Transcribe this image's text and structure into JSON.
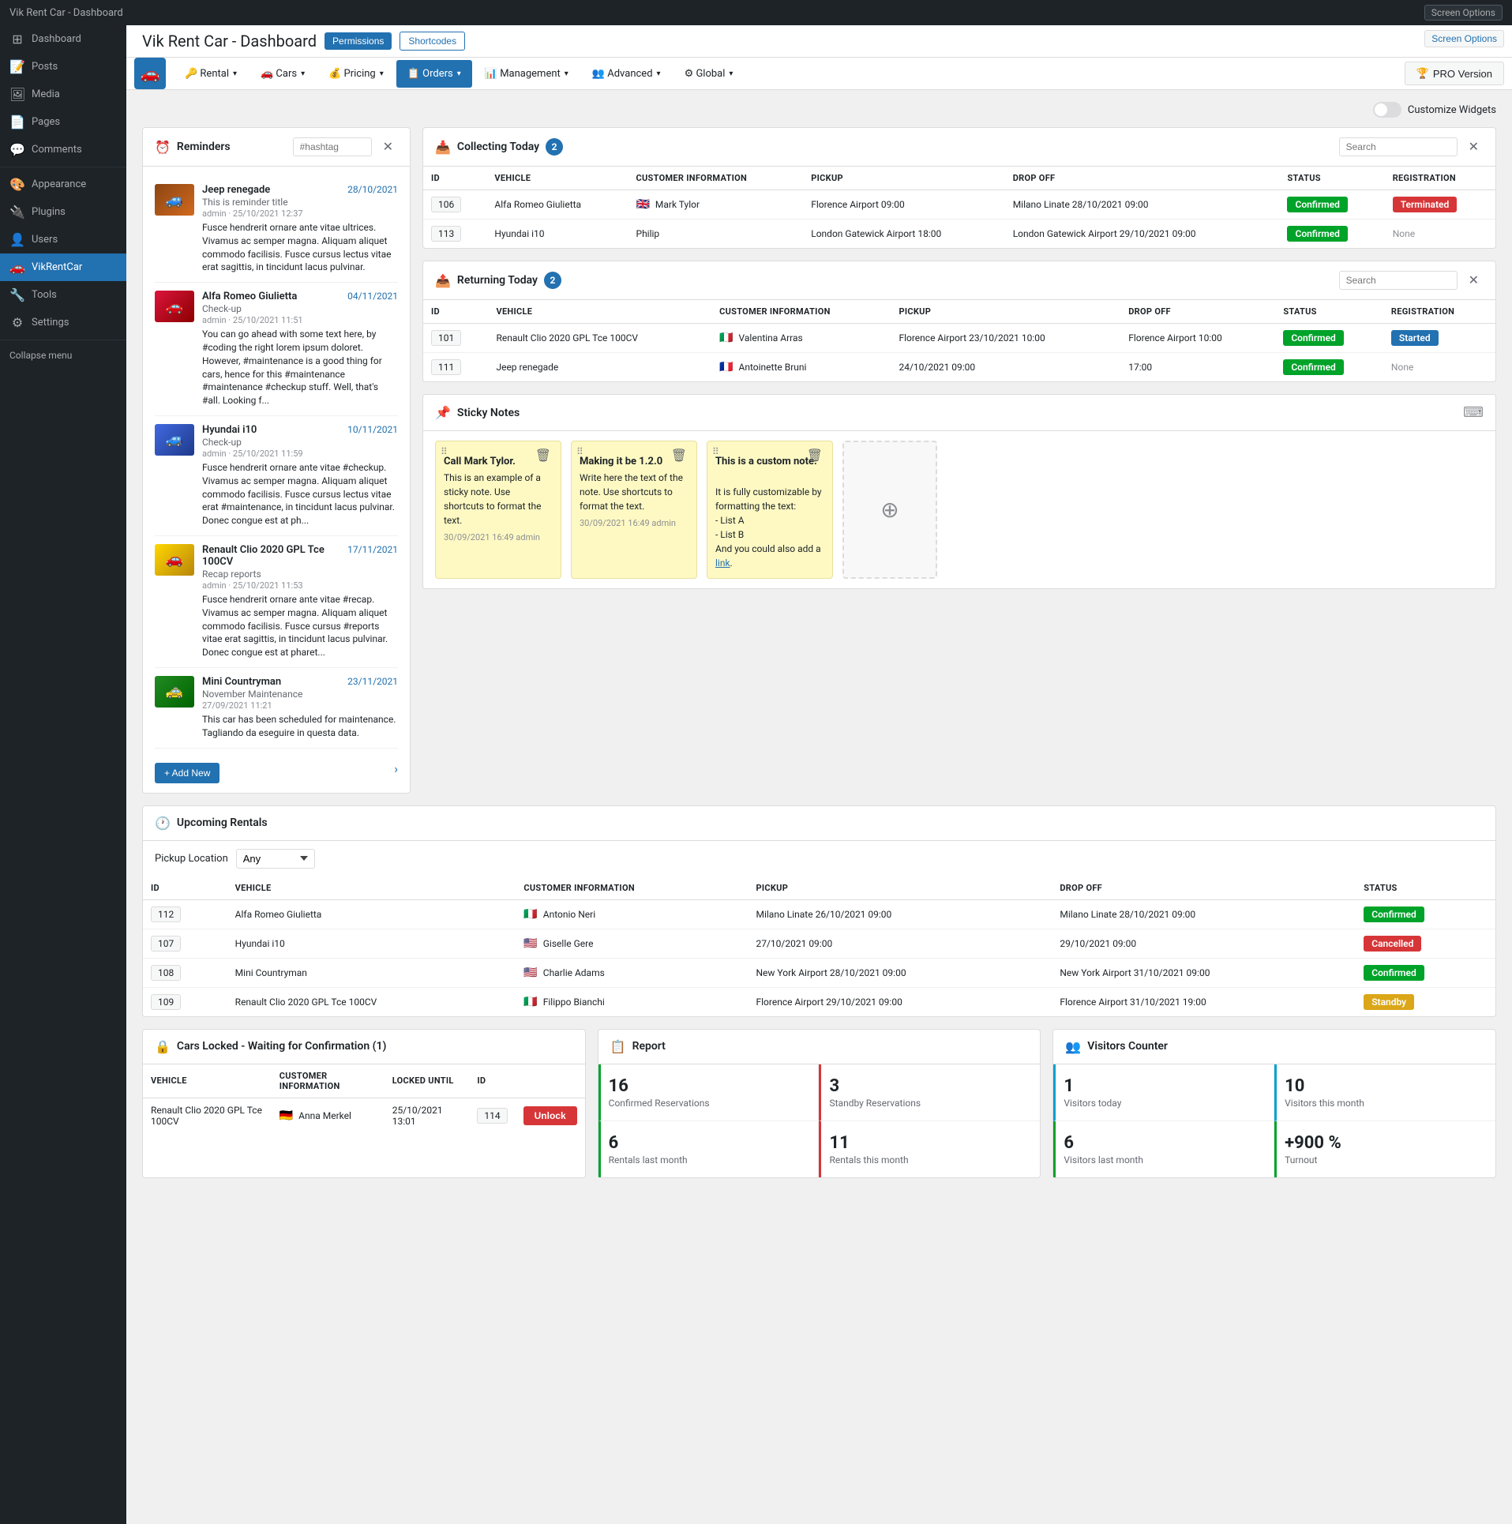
{
  "adminBar": {
    "screenOptions": "Screen Options"
  },
  "pageHeader": {
    "title": "Vik Rent Car - Dashboard",
    "permissionsLabel": "Permissions",
    "shortcodesLabel": "Shortcodes"
  },
  "nav": {
    "logoIcon": "🚗",
    "items": [
      {
        "label": "Rental",
        "hasDropdown": true
      },
      {
        "label": "Cars",
        "hasDropdown": true
      },
      {
        "label": "Pricing",
        "hasDropdown": true
      },
      {
        "label": "Orders",
        "hasDropdown": true,
        "active": true
      },
      {
        "label": "Management",
        "hasDropdown": true
      },
      {
        "label": "Advanced",
        "hasDropdown": true
      },
      {
        "label": "Global",
        "hasDropdown": true
      }
    ],
    "proVersion": "PRO Version"
  },
  "sidebar": {
    "items": [
      {
        "label": "Dashboard",
        "icon": "⊞",
        "active": false
      },
      {
        "label": "Posts",
        "icon": "📝",
        "active": false
      },
      {
        "label": "Media",
        "icon": "🖼",
        "active": false
      },
      {
        "label": "Pages",
        "icon": "📄",
        "active": false
      },
      {
        "label": "Comments",
        "icon": "💬",
        "active": false
      },
      {
        "label": "Appearance",
        "icon": "🎨",
        "active": false
      },
      {
        "label": "Plugins",
        "icon": "🔌",
        "active": false
      },
      {
        "label": "Users",
        "icon": "👤",
        "active": false
      },
      {
        "label": "VikRentCar",
        "icon": "🚗",
        "active": true
      },
      {
        "label": "Tools",
        "icon": "🔧",
        "active": false
      },
      {
        "label": "Settings",
        "icon": "⚙",
        "active": false
      }
    ],
    "collapse": "Collapse menu"
  },
  "customize": {
    "label": "Customize Widgets"
  },
  "reminders": {
    "title": "Reminders",
    "searchPlaceholder": "#hashtag",
    "addNewLabel": "+ Add New",
    "items": [
      {
        "car": "Jeep renegade",
        "subtitle": "This is reminder title",
        "date": "28/10/2021",
        "meta": "admin · 25/10/2021 12:37",
        "text": "Fusce hendrerit ornare ante vitae ultrices. Vivamus ac semper magna. Aliquam aliquet commodo facilisis. Fusce cursus lectus vitae erat sagittis, in tincidunt lacus pulvinar.",
        "carColor": "car-jeep"
      },
      {
        "car": "Alfa Romeo Giulietta",
        "subtitle": "Check-up",
        "date": "04/11/2021",
        "meta": "admin · 25/10/2021 11:51",
        "text": "You can go ahead with some text here, by #coding the right lorem ipsum doloret. However, #maintenance is a good thing for cars, hence for this #maintenance #maintenance #checkup stuff. Well, that's #all. Looking f...",
        "carColor": "car-alfa"
      },
      {
        "car": "Hyundai i10",
        "subtitle": "Check-up",
        "date": "10/11/2021",
        "meta": "admin · 25/10/2021 11:59",
        "text": "Fusce hendrerit ornare ante vitae #checkup. Vivamus ac semper magna. Aliquam aliquet commodo facilisis. Fusce cursus lectus vitae erat #maintenance, in tincidunt lacus pulvinar. Donec congue est at ph...",
        "carColor": "car-hyundai"
      },
      {
        "car": "Renault Clio 2020 GPL Tce 100CV",
        "subtitle": "Recap reports",
        "date": "17/11/2021",
        "meta": "admin · 25/10/2021 11:53",
        "text": "Fusce hendrerit ornare ante vitae #recap. Vivamus ac semper magna. Aliquam aliquet commodo facilisis. Fusce cursus #reports vitae erat sagittis, in tincidunt lacus pulvinar. Donec congue est at pharet...",
        "carColor": "car-renault"
      },
      {
        "car": "Mini Countryman",
        "subtitle": "November Maintenance",
        "date": "23/11/2021",
        "meta": "27/09/2021 11:21",
        "text": "This car has been scheduled for maintenance. Tagliando da eseguire in questa data.",
        "carColor": "car-mini"
      }
    ]
  },
  "collectingToday": {
    "title": "Collecting Today",
    "count": "2",
    "columns": [
      "ID",
      "VEHICLE",
      "CUSTOMER INFORMATION",
      "PICKUP",
      "DROP OFF",
      "STATUS",
      "REGISTRATION"
    ],
    "rows": [
      {
        "id": "106",
        "vehicle": "Alfa Romeo Giulietta",
        "customerFlag": "🇬🇧",
        "customer": "Mark Tylor",
        "pickup": "Florence Airport 09:00",
        "dropoff": "Milano Linate 28/10/2021 09:00",
        "status": "Confirmed",
        "statusClass": "status-confirmed",
        "registration": "Terminated",
        "regClass": "status-terminated"
      },
      {
        "id": "113",
        "vehicle": "Hyundai i10",
        "customerFlag": "",
        "customer": "Philip",
        "pickup": "London Gatewick Airport 18:00",
        "dropoff": "London Gatewick Airport 29/10/2021 09:00",
        "status": "Confirmed",
        "statusClass": "status-confirmed",
        "registration": "None",
        "regClass": "status-none"
      }
    ]
  },
  "returningToday": {
    "title": "Returning Today",
    "count": "2",
    "columns": [
      "ID",
      "VEHICLE",
      "CUSTOMER INFORMATION",
      "PICKUP",
      "DROP OFF",
      "STATUS",
      "REGISTRATION"
    ],
    "rows": [
      {
        "id": "101",
        "vehicle": "Renault Clio 2020 GPL Tce 100CV",
        "customerFlag": "🇮🇹",
        "customer": "Valentina Arras",
        "pickup": "Florence Airport 23/10/2021 10:00",
        "dropoff": "Florence Airport 10:00",
        "status": "Confirmed",
        "statusClass": "status-confirmed",
        "registration": "Started",
        "regClass": "status-started"
      },
      {
        "id": "111",
        "vehicle": "Jeep renegade",
        "customerFlag": "🇫🇷",
        "customer": "Antoinette Bruni",
        "pickup": "24/10/2021 09:00",
        "dropoff": "17:00",
        "status": "Confirmed",
        "statusClass": "status-confirmed",
        "registration": "None",
        "regClass": "status-none"
      }
    ]
  },
  "stickyNotes": {
    "title": "Sticky Notes",
    "notes": [
      {
        "title": "Call Mark Tylor.",
        "text": "This is an example of a sticky note. Use shortcuts to format the text.",
        "meta": "30/09/2021 16:49 admin"
      },
      {
        "title": "Making it be 1.2.0",
        "text": "Write here the text of the note. Use shortcuts to format the text.",
        "meta": "30/09/2021 16:49 admin"
      },
      {
        "title": "This is a custom note.",
        "text": "It is fully customizable by formatting the text:\n- List A\n- List B\nAnd you could also add a link.",
        "meta": ""
      }
    ]
  },
  "upcomingRentals": {
    "title": "Upcoming Rentals",
    "pickupLabel": "Pickup Location",
    "pickupValue": "Any",
    "pickupOptions": [
      "Any"
    ],
    "columns": [
      "ID",
      "VEHICLE",
      "CUSTOMER INFORMATION",
      "PICKUP",
      "DROP OFF",
      "STATUS"
    ],
    "rows": [
      {
        "id": "112",
        "vehicle": "Alfa Romeo Giulietta",
        "customerFlag": "🇮🇹",
        "customer": "Antonio Neri",
        "pickup": "Milano Linate 26/10/2021 09:00",
        "dropoff": "Milano Linate 28/10/2021 09:00",
        "status": "Confirmed",
        "statusClass": "status-confirmed"
      },
      {
        "id": "107",
        "vehicle": "Hyundai i10",
        "customerFlag": "🇺🇸",
        "customer": "Giselle Gere",
        "pickup": "27/10/2021 09:00",
        "dropoff": "29/10/2021 09:00",
        "status": "Cancelled",
        "statusClass": "status-cancelled"
      },
      {
        "id": "108",
        "vehicle": "Mini Countryman",
        "customerFlag": "🇺🇸",
        "customer": "Charlie Adams",
        "pickup": "New York Airport 28/10/2021 09:00",
        "dropoff": "New York Airport 31/10/2021 09:00",
        "status": "Confirmed",
        "statusClass": "status-confirmed"
      },
      {
        "id": "109",
        "vehicle": "Renault Clio 2020 GPL Tce 100CV",
        "customerFlag": "🇮🇹",
        "customer": "Filippo Bianchi",
        "pickup": "Florence Airport 29/10/2021 09:00",
        "dropoff": "Florence Airport 31/10/2021 19:00",
        "status": "Standby",
        "statusClass": "status-standby"
      }
    ]
  },
  "carsLocked": {
    "title": "Cars Locked - Waiting for Confirmation (1)",
    "columns": [
      "VEHICLE",
      "CUSTOMER INFORMATION",
      "LOCKED UNTIL",
      "ID"
    ],
    "rows": [
      {
        "vehicle": "Renault Clio 2020 GPL Tce 100CV",
        "customerFlag": "🇩🇪",
        "customer": "Anna Merkel",
        "lockedUntil": "25/10/2021 13:01",
        "id": "114",
        "unlockLabel": "Unlock"
      }
    ]
  },
  "report": {
    "title": "Report",
    "stats": [
      {
        "number": "16",
        "label": "Confirmed Reservations",
        "accent": "green"
      },
      {
        "number": "3",
        "label": "Standby Reservations",
        "accent": "red"
      },
      {
        "number": "6",
        "label": "Rentals last month",
        "accent": "green"
      },
      {
        "number": "11",
        "label": "Rentals this month",
        "accent": "red"
      }
    ]
  },
  "visitorsCounter": {
    "title": "Visitors Counter",
    "stats": [
      {
        "number": "1",
        "label": "Visitors today",
        "accent": "teal"
      },
      {
        "number": "10",
        "label": "Visitors this month",
        "accent": "teal"
      },
      {
        "number": "6",
        "label": "Visitors last month",
        "accent": "green"
      },
      {
        "number": "+900 %",
        "label": "Turnout",
        "accent": "green"
      }
    ]
  }
}
